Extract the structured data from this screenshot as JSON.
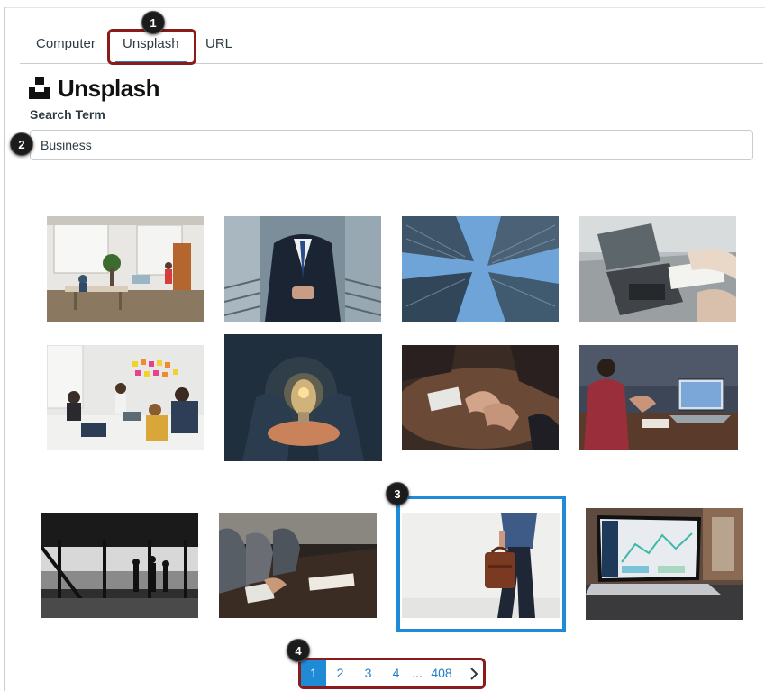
{
  "tabs": [
    {
      "label": "Computer"
    },
    {
      "label": "Unsplash"
    },
    {
      "label": "URL"
    }
  ],
  "callouts": [
    "1",
    "2",
    "3",
    "4"
  ],
  "brand": {
    "name": "Unsplash"
  },
  "search": {
    "label": "Search Term",
    "value": "Business"
  },
  "pagination": {
    "pages": [
      "1",
      "2",
      "3",
      "4"
    ],
    "ellipsis": "...",
    "last": "408",
    "next_icon": "chevron-right-icon",
    "current": "1"
  },
  "colors": {
    "accent": "#1f8ad6",
    "callout": "#8b1a1a",
    "tab_underline": "#2b7abc"
  }
}
